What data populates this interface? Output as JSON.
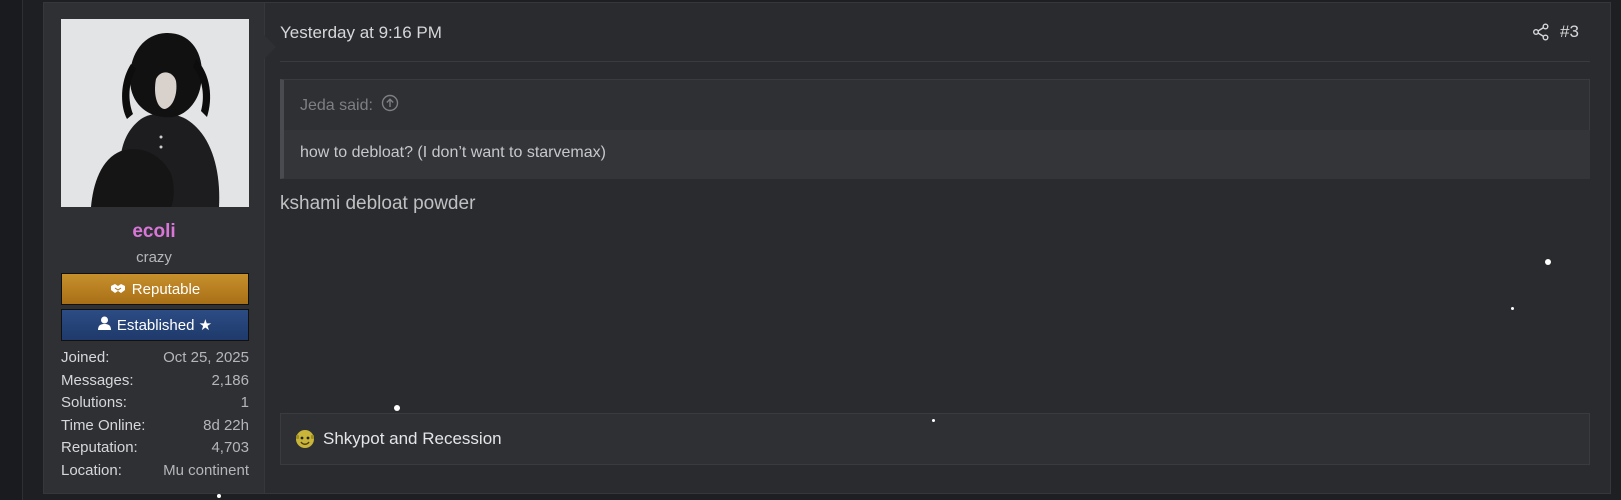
{
  "post": {
    "user": {
      "avatar_icon": "user-avatar-photo",
      "name": "ecoli",
      "name_color": "#d877d8",
      "title": "crazy",
      "banners": [
        {
          "label": "Reputable",
          "icon": "handshake-icon",
          "color": "#b37c20"
        },
        {
          "label": "Established ★",
          "icon": "user-icon",
          "color": "#25447a"
        }
      ],
      "stats": [
        {
          "key": "Joined:",
          "value": "Oct 25, 2025"
        },
        {
          "key": "Messages:",
          "value": "2,186"
        },
        {
          "key": "Solutions:",
          "value": "1"
        },
        {
          "key": "Time Online:",
          "value": "8d 22h"
        },
        {
          "key": "Reputation:",
          "value": "4,703"
        },
        {
          "key": "Location:",
          "value": "Mu continent"
        }
      ]
    },
    "date": "Yesterday at 9:16 PM",
    "share_icon": "share-icon",
    "number": "#3",
    "quote": {
      "author": "Jeda said:",
      "jump_icon": "arrow-up-circle-icon",
      "text": "how to debloat? (I don’t want to starvemax)"
    },
    "message": "kshami debloat powder",
    "signature": {
      "emoji_icon": "shrek-emoji-icon",
      "text": "Shkypot and Recession"
    }
  }
}
